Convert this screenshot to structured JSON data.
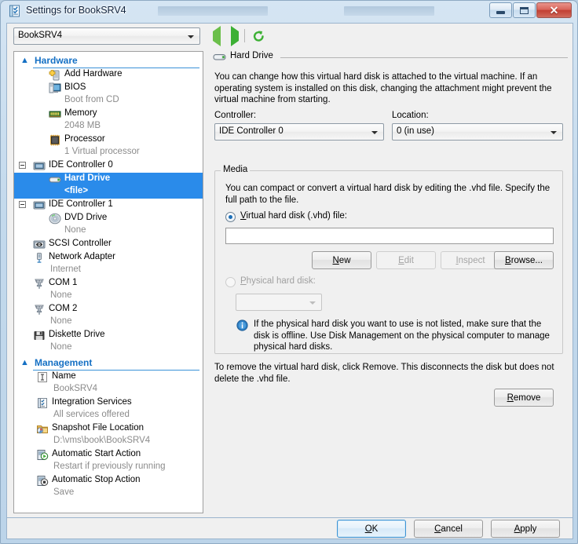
{
  "window": {
    "title": "Settings for BookSRV4",
    "icon": "settings-document-icon",
    "minimize_label": "Minimize",
    "maximize_label": "Maximize",
    "close_label": "Close"
  },
  "toolbar": {
    "vm_selector_value": "BookSRV4",
    "back_label": "Back",
    "forward_label": "Forward",
    "refresh_label": "Refresh"
  },
  "tree": {
    "groups": [
      {
        "label": "Hardware",
        "items": [
          {
            "label": "Add Hardware",
            "sub": "",
            "icon": "add-hardware-icon",
            "indent": 0,
            "expander": false,
            "selected": false
          },
          {
            "label": "BIOS",
            "sub": "Boot from CD",
            "icon": "bios-icon",
            "indent": 0,
            "expander": false,
            "selected": false
          },
          {
            "label": "Memory",
            "sub": "2048 MB",
            "icon": "memory-icon",
            "indent": 0,
            "expander": false,
            "selected": false
          },
          {
            "label": "Processor",
            "sub": "1 Virtual processor",
            "icon": "processor-icon",
            "indent": 0,
            "expander": false,
            "selected": false
          },
          {
            "label": "IDE Controller 0",
            "sub": "",
            "icon": "ide-controller-icon",
            "indent": 0,
            "expander": true,
            "selected": false
          },
          {
            "label": "Hard Drive",
            "sub": "<file>",
            "icon": "hard-drive-icon",
            "indent": 1,
            "expander": false,
            "selected": true
          },
          {
            "label": "IDE Controller 1",
            "sub": "",
            "icon": "ide-controller-icon",
            "indent": 0,
            "expander": true,
            "selected": false
          },
          {
            "label": "DVD Drive",
            "sub": "None",
            "icon": "dvd-drive-icon",
            "indent": 1,
            "expander": false,
            "selected": false
          },
          {
            "label": "SCSI Controller",
            "sub": "",
            "icon": "scsi-controller-icon",
            "indent": 0,
            "expander": false,
            "selected": false
          },
          {
            "label": "Network Adapter",
            "sub": "Internet",
            "icon": "network-adapter-icon",
            "indent": 0,
            "expander": false,
            "selected": false
          },
          {
            "label": "COM 1",
            "sub": "None",
            "icon": "com-port-icon",
            "indent": 0,
            "expander": false,
            "selected": false
          },
          {
            "label": "COM 2",
            "sub": "None",
            "icon": "com-port-icon",
            "indent": 0,
            "expander": false,
            "selected": false
          },
          {
            "label": "Diskette Drive",
            "sub": "None",
            "icon": "diskette-drive-icon",
            "indent": 0,
            "expander": false,
            "selected": false
          }
        ]
      },
      {
        "label": "Management",
        "items": [
          {
            "label": "Name",
            "sub": "BookSRV4",
            "icon": "name-icon",
            "indent": 0,
            "expander": false,
            "selected": false
          },
          {
            "label": "Integration Services",
            "sub": "All services offered",
            "icon": "integration-services-icon",
            "indent": 0,
            "expander": false,
            "selected": false
          },
          {
            "label": "Snapshot File Location",
            "sub": "D:\\vms\\book\\BookSRV4",
            "icon": "snapshot-folder-icon",
            "indent": 0,
            "expander": false,
            "selected": false
          },
          {
            "label": "Automatic Start Action",
            "sub": "Restart if previously running",
            "icon": "auto-start-icon",
            "indent": 0,
            "expander": false,
            "selected": false
          },
          {
            "label": "Automatic Stop Action",
            "sub": "Save",
            "icon": "auto-stop-icon",
            "indent": 0,
            "expander": false,
            "selected": false
          }
        ]
      }
    ]
  },
  "pane": {
    "heading": "Hard Drive",
    "heading_icon": "hard-drive-icon",
    "description": "You can change how this virtual hard disk is attached to the virtual machine. If an operating system is installed on this disk, changing the attachment might prevent the virtual machine from starting.",
    "controller_label": "Controller:",
    "controller_value": "IDE Controller 0",
    "location_label": "Location:",
    "location_value": "0 (in use)",
    "media": {
      "legend": "Media",
      "description": "You can compact or convert a virtual hard disk by editing the .vhd file. Specify the full path to the file.",
      "vhd_radio_label": "Virtual hard disk (.vhd) file:",
      "vhd_radio_checked": true,
      "vhd_path_value": "",
      "vhd_path_placeholder": "",
      "buttons": {
        "new": "New",
        "edit": "Edit",
        "inspect": "Inspect",
        "browse": "Browse..."
      },
      "physical_radio_label": "Physical hard disk:",
      "physical_radio_checked": false,
      "physical_disk_value": "",
      "info_icon": "info-icon",
      "info_text": "If the physical hard disk you want to use is not listed, make sure that the disk is offline. Use Disk Management on the physical computer to manage physical hard disks."
    },
    "remove_description": "To remove the virtual hard disk, click Remove. This disconnects the disk but does not delete the .vhd file.",
    "remove_button": "Remove"
  },
  "footer": {
    "ok": "OK",
    "cancel": "Cancel",
    "apply": "Apply"
  },
  "colors": {
    "accent": "#2a8bea",
    "group_header": "#1570c4",
    "nav_green": "#3cb034",
    "close_red": "#c23f33"
  }
}
